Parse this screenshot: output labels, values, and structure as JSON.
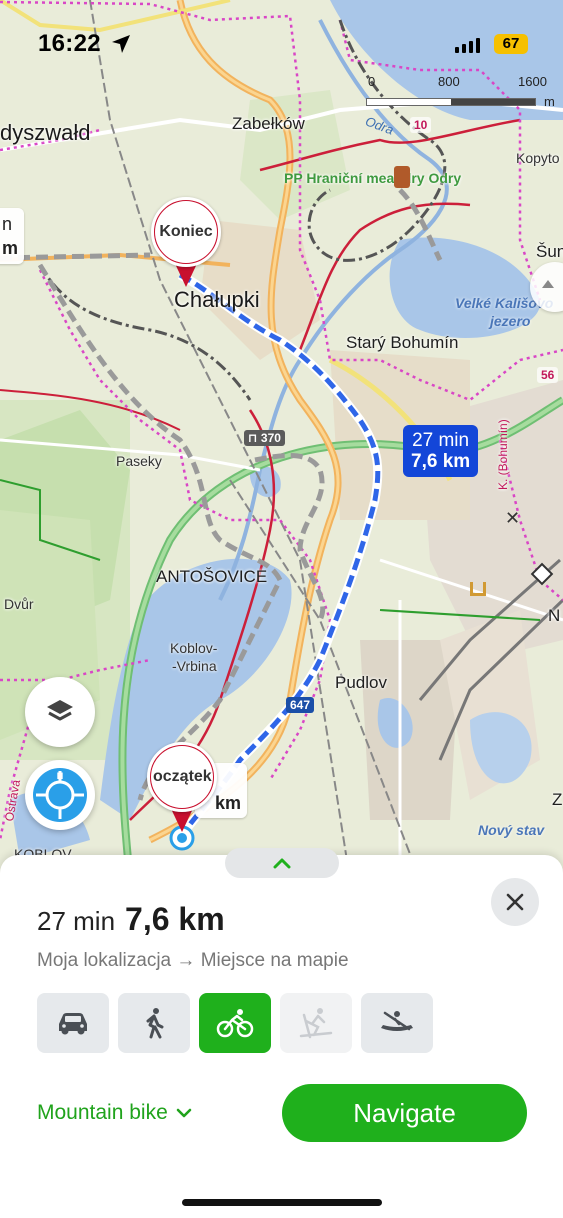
{
  "status": {
    "time": "16:22",
    "battery": "67"
  },
  "scale": {
    "t0": "0",
    "t1": "800",
    "t2": "1600",
    "unit": "m"
  },
  "map": {
    "labels": {
      "dyszwald": "dyszwałd",
      "zabelkow": "Zabełków",
      "pp": "PP Hraniční meandry Odry",
      "odra": "Odra",
      "kopyto": "Kopyto",
      "chalupki": "Chałupki",
      "stary_bohumin": "Starý Bohumín",
      "velke_kalisovo": "Velké Kališovo",
      "jezero": "jezero",
      "sun": "Šun",
      "paseky": "Paseky",
      "antosovice": "ANTOŠOVICE",
      "dvur": "Dvůr",
      "koblov_vrbina_1": "Koblov-",
      "koblov_vrbina_2": "-Vrbina",
      "pudlov": "Pudlov",
      "novy_stav": "Nový stav",
      "koblov": "KOBLOV",
      "k_bohumin": "K. (Bohumín)",
      "ostrava": "Ostrava",
      "n_edge": "N",
      "z_edge": "Z"
    },
    "shields": {
      "r10": "10",
      "r56": "56",
      "r370": "370",
      "r647": "647"
    },
    "route_bubble": {
      "time": "27 min",
      "dist": "7,6 km"
    },
    "left_edge_card": {
      "line1": "n",
      "line2": "m"
    },
    "end_pin": "Koniec",
    "start_pin": "oczątek",
    "start_card": "km"
  },
  "sheet": {
    "time": "27 min",
    "distance": "7,6 km",
    "from": "Moja lokalizacja",
    "arrow": "→",
    "to": "Miejsce na mapie",
    "modes": [
      {
        "icon": "car-icon",
        "state": "normal"
      },
      {
        "icon": "walk-icon",
        "state": "normal"
      },
      {
        "icon": "bike-icon",
        "state": "active"
      },
      {
        "icon": "ski-icon",
        "state": "disabled"
      },
      {
        "icon": "kayak-icon",
        "state": "normal"
      }
    ],
    "profile": "Mountain bike",
    "navigate": "Navigate"
  },
  "colors": {
    "accent": "#1fb01c",
    "route": "#1346d8",
    "pin": "#c8102e"
  }
}
